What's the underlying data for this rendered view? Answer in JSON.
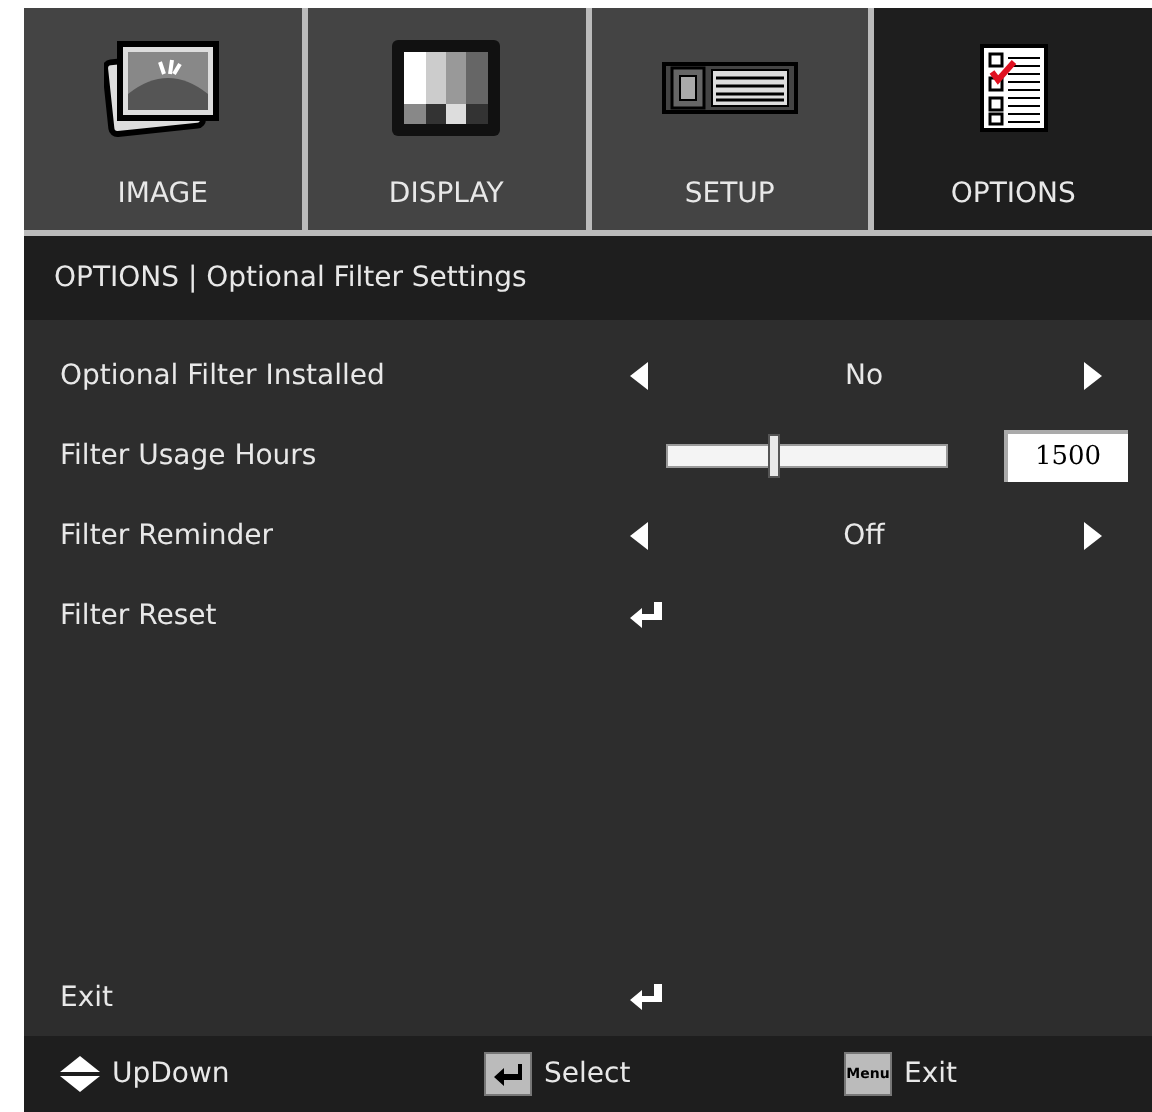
{
  "tabs": [
    {
      "label": "IMAGE",
      "kind": "image",
      "selected": false
    },
    {
      "label": "DISPLAY",
      "kind": "display",
      "selected": false
    },
    {
      "label": "SETUP",
      "kind": "setup",
      "selected": false
    },
    {
      "label": "OPTIONS",
      "kind": "options",
      "selected": true
    }
  ],
  "breadcrumb": "OPTIONS | Optional Filter Settings",
  "rows": [
    {
      "kind": "choice",
      "label": "Optional Filter Installed",
      "value": "No"
    },
    {
      "kind": "slider",
      "label": "Filter Usage Hours",
      "level": 0.38,
      "value": "1500"
    },
    {
      "kind": "choice",
      "label": "Filter Reminder",
      "value": "Off"
    },
    {
      "kind": "action",
      "label": "Filter Reset"
    }
  ],
  "exit": {
    "label": "Exit"
  },
  "footer": [
    {
      "kind": "updown",
      "label": "UpDown"
    },
    {
      "kind": "enter",
      "label": "Select"
    },
    {
      "kind": "menu",
      "key": "Menu",
      "label": "Exit"
    }
  ]
}
